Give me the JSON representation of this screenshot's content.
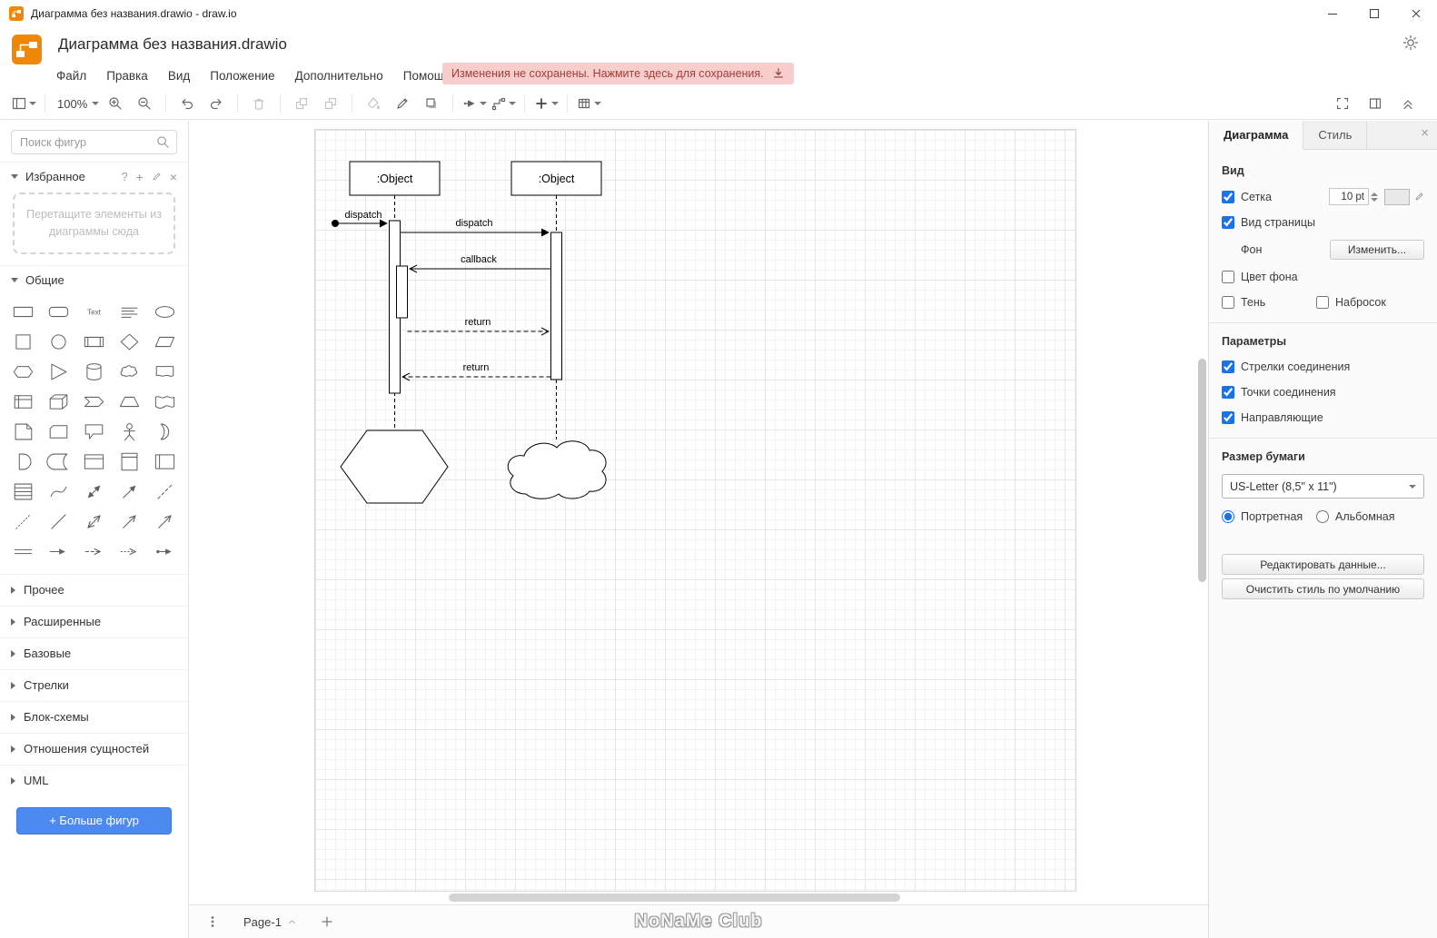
{
  "window": {
    "title": "Диаграмма без названия.drawio - draw.io"
  },
  "header": {
    "title": "Диаграмма без названия.drawio",
    "menus": [
      "Файл",
      "Правка",
      "Вид",
      "Положение",
      "Дополнительно",
      "Помощь"
    ],
    "banner": "Изменения не сохранены. Нажмите здесь для сохранения."
  },
  "toolbar": {
    "zoom": "100%"
  },
  "sidebar": {
    "search_placeholder": "Поиск фигур",
    "favorites_title": "Избранное",
    "favorites_help": "?",
    "favorites_add": "+",
    "favorites_close": "×",
    "drop_hint": "Перетащите элементы из диаграммы сюда",
    "general_title": "Общие",
    "text_shape_label": "Text",
    "shapes": [
      "rectangle",
      "rounded-rectangle",
      "text",
      "textbox",
      "ellipse",
      "square",
      "circle",
      "process",
      "diamond",
      "parallelogram",
      "hexagon",
      "triangle",
      "cylinder",
      "cloud",
      "document",
      "internal-storage",
      "cube",
      "step",
      "trapezoid",
      "tape",
      "note",
      "card",
      "callout",
      "actor",
      "or",
      "and",
      "data-storage",
      "container",
      "vertical-container",
      "horizontal-container",
      "list",
      "curve",
      "bidirectional-arrow",
      "arrow",
      "dashed-line",
      "dotted-line",
      "line",
      "bidirectional-connector",
      "directional-connector",
      "arrow-open",
      "link",
      "arrow-connector",
      "dashed-connector",
      "dotted-connector",
      "labeled-connector"
    ],
    "sections": [
      "Прочее",
      "Расширенные",
      "Базовые",
      "Стрелки",
      "Блок-схемы",
      "Отношения сущностей",
      "UML"
    ],
    "more_shapes_label": "+ Больше фигур"
  },
  "diagram": {
    "object1": ":Object",
    "object2": ":Object",
    "msg_dispatch1": "dispatch",
    "msg_dispatch2": "dispatch",
    "msg_callback": "callback",
    "msg_return1": "return",
    "msg_return2": "return"
  },
  "panel": {
    "tab_diagram": "Диаграмма",
    "tab_style": "Стиль",
    "view_title": "Вид",
    "grid_label": "Сетка",
    "grid_size": "10 pt",
    "page_view_label": "Вид страницы",
    "background_label": "Фон",
    "change_button": "Изменить...",
    "bg_color_label": "Цвет фона",
    "shadow_label": "Тень",
    "sketch_label": "Набросок",
    "options_title": "Параметры",
    "options": [
      "Стрелки соединения",
      "Точки соединения",
      "Направляющие"
    ],
    "paper_title": "Размер бумаги",
    "paper_value": "US-Letter (8,5\" x 11\")",
    "portrait_label": "Портретная",
    "landscape_label": "Альбомная",
    "edit_data_button": "Редактировать данные...",
    "clear_style_button": "Очистить стиль по умолчанию"
  },
  "footer": {
    "page_tab": "Page-1",
    "watermark": "NoNaMe Club"
  },
  "colors": {
    "accent": "#1a73e8",
    "logo_orange": "#F08705",
    "banner_bg": "#f8cecc",
    "banner_text": "#9f3e3c",
    "more_shapes_blue": "#4d8af0"
  }
}
